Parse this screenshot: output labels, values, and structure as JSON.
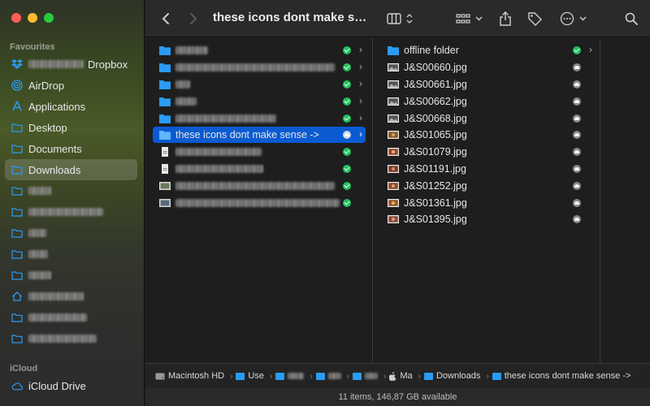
{
  "window": {
    "title": "these icons dont make sense ->"
  },
  "sidebar": {
    "favourites_header": "Favourites",
    "items": [
      {
        "label": "Dropbox",
        "icon": "dropbox-icon"
      },
      {
        "label": "AirDrop",
        "icon": "airdrop-icon"
      },
      {
        "label": "Applications",
        "icon": "applications-icon"
      },
      {
        "label": "Desktop",
        "icon": "folder-icon"
      },
      {
        "label": "Documents",
        "icon": "folder-icon"
      },
      {
        "label": "Downloads",
        "icon": "folder-icon",
        "active": true
      }
    ],
    "icloud_header": "iCloud",
    "icloud_items": [
      {
        "label": "iCloud Drive",
        "icon": "cloud-icon"
      }
    ]
  },
  "column2": {
    "items": [
      {
        "name": "offline folder",
        "type": "folder",
        "status": "synced"
      },
      {
        "name": "J&S00660.jpg",
        "type": "image",
        "status": "cloud"
      },
      {
        "name": "J&S00661.jpg",
        "type": "image",
        "status": "cloud"
      },
      {
        "name": "J&S00662.jpg",
        "type": "image",
        "status": "cloud"
      },
      {
        "name": "J&S00668.jpg",
        "type": "image",
        "status": "cloud"
      },
      {
        "name": "J&S01065.jpg",
        "type": "image",
        "status": "cloud"
      },
      {
        "name": "J&S01079.jpg",
        "type": "image",
        "status": "cloud"
      },
      {
        "name": "J&S01191.jpg",
        "type": "image",
        "status": "cloud"
      },
      {
        "name": "J&S01252.jpg",
        "type": "image",
        "status": "cloud"
      },
      {
        "name": "J&S01361.jpg",
        "type": "image",
        "status": "cloud"
      },
      {
        "name": "J&S01395.jpg",
        "type": "image",
        "status": "cloud"
      }
    ]
  },
  "column1": {
    "selected_item": "these icons dont make sense ->"
  },
  "pathbar": {
    "disk": "Macintosh HD",
    "users": "Use",
    "mac": "Ma",
    "downloads": "Downloads",
    "current": "these icons dont make sense ->"
  },
  "statusbar": {
    "text": "11 items, 146,87 GB available"
  },
  "colors": {
    "accent": "#0a5bd1",
    "folder": "#2b9bf4",
    "synced": "#21c25e"
  }
}
